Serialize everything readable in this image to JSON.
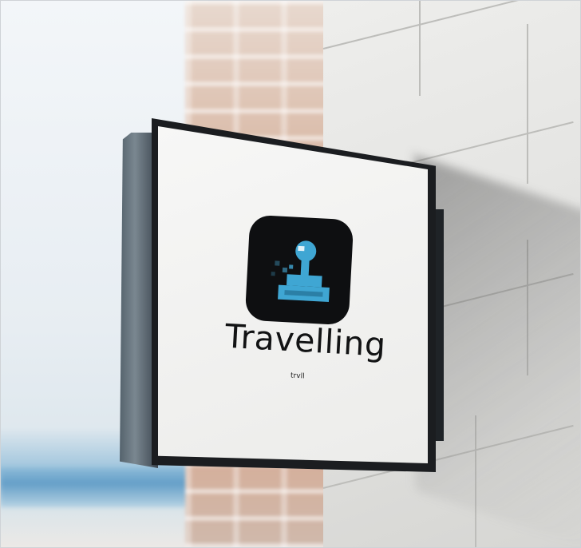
{
  "sign": {
    "brand_name": "Travelling",
    "tagline": "trvll"
  },
  "logo": {
    "icon": "joystick-icon",
    "tile_color": "#0e0f11",
    "accent_color": "#3fa6d3"
  },
  "colors": {
    "wall": "#e3e3e1",
    "sign_frame": "#1b1d20",
    "sign_face": "#f2f2f0"
  }
}
